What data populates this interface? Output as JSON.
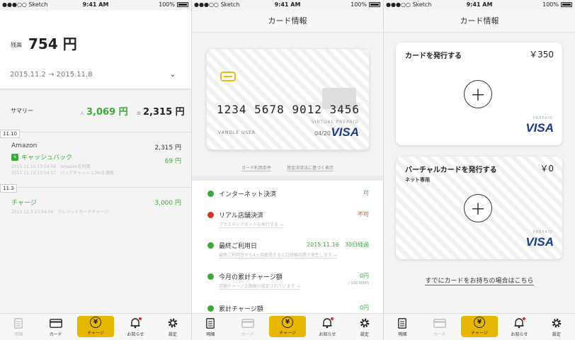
{
  "status": {
    "carrier": "●●●○○ Sketch",
    "time": "9:41 AM",
    "battery": "100%"
  },
  "tabs": [
    {
      "label": "明細",
      "icon": "doc-icon"
    },
    {
      "label": "カード",
      "icon": "card-icon"
    },
    {
      "label": "チャージ",
      "icon": "yen-coin-icon"
    },
    {
      "label": "お知らせ",
      "icon": "bell-icon"
    },
    {
      "label": "設定",
      "icon": "gear-icon"
    }
  ],
  "s1": {
    "balance_label": "残高",
    "balance": "754 円",
    "period_start": "2015.11.2",
    "arrow": "→",
    "period_end": "2015.11.8",
    "summary_label": "サマリー",
    "in_label": "入",
    "in_amount": "3,069 円",
    "out_label": "出",
    "out_amount": "2,315 円",
    "date1": "11.10",
    "tx1_name": "Amazon",
    "tx1_amount": "2,315 円",
    "tx1_cashback": "キャッシュバック",
    "tx1_cashback_amount": "69 円",
    "tx1_meta1": "2015.11.10 13:54:56　Amazonを利用",
    "tx1_meta2": "2015.11.10 13:54:57　バックキャッシュ3%を適用",
    "date2": "11.3",
    "tx2_name": "チャージ",
    "tx2_amount": "3,000 円",
    "tx2_meta": "2015.11.3 13:54:56　クレジットカードチャージ"
  },
  "s2": {
    "title": "カード情報",
    "card_number": "1234 5678 9012 3456",
    "holder": "VANDLE USER",
    "virtual": "VIRTUAL PREPAID",
    "expiry": "04/20",
    "visa": "VISA",
    "link1": "カード利用条件",
    "link2": "資金決済法に基づく表示",
    "rows": [
      {
        "label": "インターネット決済",
        "value": "可",
        "color": "#3aaa35"
      },
      {
        "label": "リアル店舗決済",
        "value": "不可",
        "color": "#e23b2a",
        "sub": "プラスチックカードを発行する →"
      },
      {
        "label": "最終ご利用日",
        "value": "2015.11.16　30日経過",
        "color": "#3aaa35",
        "sub": "最終ご利用日から4ヶ月経過すると口座維持費が発生します →"
      },
      {
        "label": "今月の累計チャージ額",
        "value": "0円",
        "small": "/ 100,000円",
        "color": "#3aaa35",
        "sub": "月額チャージ上限額が設定されています →"
      },
      {
        "label": "累計チャージ額",
        "value": "0円",
        "color": "#3aaa35"
      }
    ],
    "dot_color": "#3aaa35",
    "dot_red": "#d9302a"
  },
  "s3": {
    "title": "カード情報",
    "card1_title": "カードを発行する",
    "card1_price": "￥350",
    "card2_title": "バーチャルカードを発行する",
    "card2_price": "￥0",
    "card2_sub": "ネット専用",
    "prepaid": "PREPAID",
    "visa": "VISA",
    "plus": "＋",
    "already": "すでにカードをお持ちの場合はこちら"
  }
}
